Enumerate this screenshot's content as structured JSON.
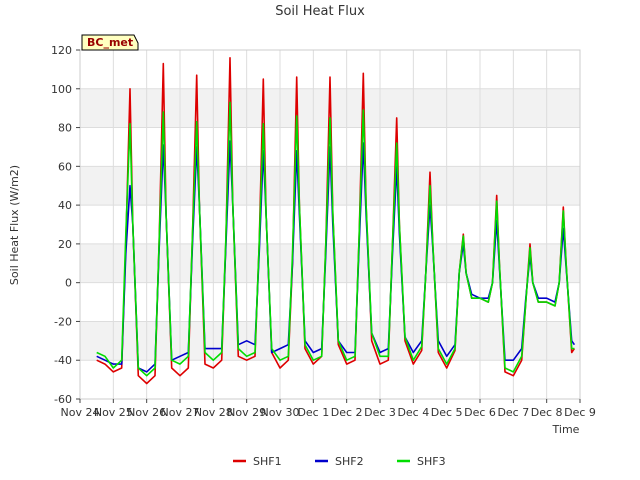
{
  "chart_data": {
    "type": "line",
    "title": "Soil Heat Flux",
    "xlabel": "Time",
    "ylabel": "Soil Heat Flux (W/m2)",
    "station_label": "BC_met",
    "ylim": [
      -60,
      120
    ],
    "yticks": [
      -60,
      -40,
      -20,
      0,
      20,
      40,
      60,
      80,
      100,
      120
    ],
    "xlim": [
      "2023-11-24",
      "2023-12-09"
    ],
    "xtick_labels": [
      "Nov 24",
      "Nov 25",
      "Nov 26",
      "Nov 27",
      "Nov 28",
      "Nov 29",
      "Nov 30",
      "Dec 1",
      "Dec 2",
      "Dec 3",
      "Dec 4",
      "Dec 5",
      "Dec 6",
      "Dec 7",
      "Dec 8",
      "Dec 9"
    ],
    "grid": true,
    "legend_position": "bottom",
    "x": [
      "2023-11-24 12:00",
      "2023-11-24 18:00",
      "2023-11-25 00:00",
      "2023-11-25 06:00",
      "2023-11-25 09:00",
      "2023-11-25 12:00",
      "2023-11-25 14:00",
      "2023-11-25 18:00",
      "2023-11-26 00:00",
      "2023-11-26 06:00",
      "2023-11-26 09:00",
      "2023-11-26 12:00",
      "2023-11-26 14:00",
      "2023-11-26 18:00",
      "2023-11-27 00:00",
      "2023-11-27 06:00",
      "2023-11-27 09:00",
      "2023-11-27 12:00",
      "2023-11-27 14:00",
      "2023-11-27 18:00",
      "2023-11-28 00:00",
      "2023-11-28 06:00",
      "2023-11-28 09:00",
      "2023-11-28 12:00",
      "2023-11-28 14:00",
      "2023-11-28 18:00",
      "2023-11-29 00:00",
      "2023-11-29 06:00",
      "2023-11-29 09:00",
      "2023-11-29 12:00",
      "2023-11-29 14:00",
      "2023-11-29 18:00",
      "2023-11-30 00:00",
      "2023-11-30 06:00",
      "2023-11-30 09:00",
      "2023-11-30 12:00",
      "2023-11-30 14:00",
      "2023-11-30 18:00",
      "2023-12-01 00:00",
      "2023-12-01 06:00",
      "2023-12-01 09:00",
      "2023-12-01 12:00",
      "2023-12-01 14:00",
      "2023-12-01 18:00",
      "2023-12-02 00:00",
      "2023-12-02 06:00",
      "2023-12-02 09:00",
      "2023-12-02 12:00",
      "2023-12-02 14:00",
      "2023-12-02 18:00",
      "2023-12-03 00:00",
      "2023-12-03 06:00",
      "2023-12-03 09:00",
      "2023-12-03 12:00",
      "2023-12-03 14:00",
      "2023-12-03 18:00",
      "2023-12-04 00:00",
      "2023-12-04 06:00",
      "2023-12-04 09:00",
      "2023-12-04 12:00",
      "2023-12-04 14:00",
      "2023-12-04 18:00",
      "2023-12-05 00:00",
      "2023-12-05 06:00",
      "2023-12-05 09:00",
      "2023-12-05 12:00",
      "2023-12-05 14:00",
      "2023-12-05 18:00",
      "2023-12-06 00:00",
      "2023-12-06 06:00",
      "2023-12-06 09:00",
      "2023-12-06 12:00",
      "2023-12-06 14:00",
      "2023-12-06 18:00",
      "2023-12-07 00:00",
      "2023-12-07 06:00",
      "2023-12-07 09:00",
      "2023-12-07 12:00",
      "2023-12-07 14:00",
      "2023-12-07 18:00",
      "2023-12-08 00:00",
      "2023-12-08 06:00",
      "2023-12-08 09:00",
      "2023-12-08 12:00",
      "2023-12-08 14:00",
      "2023-12-08 18:00",
      "2023-12-08 20:00"
    ],
    "series": [
      {
        "name": "SHF1",
        "color": "#dd0000",
        "values": [
          -40,
          -42,
          -46,
          -44,
          20,
          100,
          30,
          -48,
          -52,
          -48,
          22,
          113,
          35,
          -44,
          -48,
          -44,
          25,
          107,
          40,
          -42,
          -44,
          -40,
          20,
          116,
          40,
          -38,
          -40,
          -38,
          20,
          105,
          35,
          -36,
          -44,
          -40,
          10,
          106,
          40,
          -34,
          -42,
          -38,
          20,
          106,
          36,
          -32,
          -42,
          -40,
          25,
          108,
          40,
          -30,
          -42,
          -40,
          20,
          85,
          30,
          -30,
          -42,
          -35,
          5,
          57,
          20,
          -36,
          -44,
          -35,
          5,
          25,
          5,
          -8,
          -8,
          -10,
          0,
          45,
          10,
          -46,
          -48,
          -40,
          -10,
          20,
          0,
          -10,
          -10,
          -12,
          0,
          39,
          10,
          -36,
          -34
        ]
      },
      {
        "name": "SHF2",
        "color": "#0000cc",
        "values": [
          -38,
          -40,
          -42,
          -42,
          15,
          50,
          30,
          -44,
          -46,
          -42,
          18,
          71,
          35,
          -40,
          -38,
          -36,
          20,
          70,
          40,
          -34,
          -34,
          -34,
          18,
          73,
          40,
          -32,
          -30,
          -32,
          15,
          68,
          35,
          -36,
          -34,
          -32,
          10,
          68,
          35,
          -30,
          -36,
          -34,
          15,
          70,
          30,
          -30,
          -36,
          -36,
          20,
          72,
          35,
          -26,
          -36,
          -34,
          15,
          60,
          25,
          -28,
          -36,
          -30,
          5,
          40,
          18,
          -30,
          -38,
          -32,
          5,
          20,
          5,
          -6,
          -8,
          -8,
          0,
          32,
          8,
          -40,
          -40,
          -34,
          -8,
          14,
          0,
          -8,
          -8,
          -10,
          0,
          28,
          8,
          -30,
          -32
        ]
      },
      {
        "name": "SHF3",
        "color": "#00dd00",
        "values": [
          -36,
          -38,
          -44,
          -40,
          25,
          82,
          30,
          -44,
          -48,
          -44,
          22,
          88,
          35,
          -40,
          -42,
          -38,
          25,
          83,
          40,
          -36,
          -40,
          -36,
          22,
          93,
          40,
          -34,
          -38,
          -36,
          20,
          82,
          35,
          -34,
          -40,
          -38,
          15,
          86,
          40,
          -32,
          -40,
          -38,
          20,
          85,
          36,
          -30,
          -40,
          -38,
          25,
          89,
          40,
          -26,
          -38,
          -38,
          20,
          72,
          30,
          -28,
          -40,
          -33,
          5,
          50,
          20,
          -34,
          -42,
          -34,
          5,
          24,
          5,
          -8,
          -8,
          -10,
          0,
          42,
          10,
          -44,
          -46,
          -38,
          -10,
          18,
          0,
          -10,
          -10,
          -12,
          0,
          37,
          10,
          -34,
          -34
        ]
      }
    ]
  }
}
